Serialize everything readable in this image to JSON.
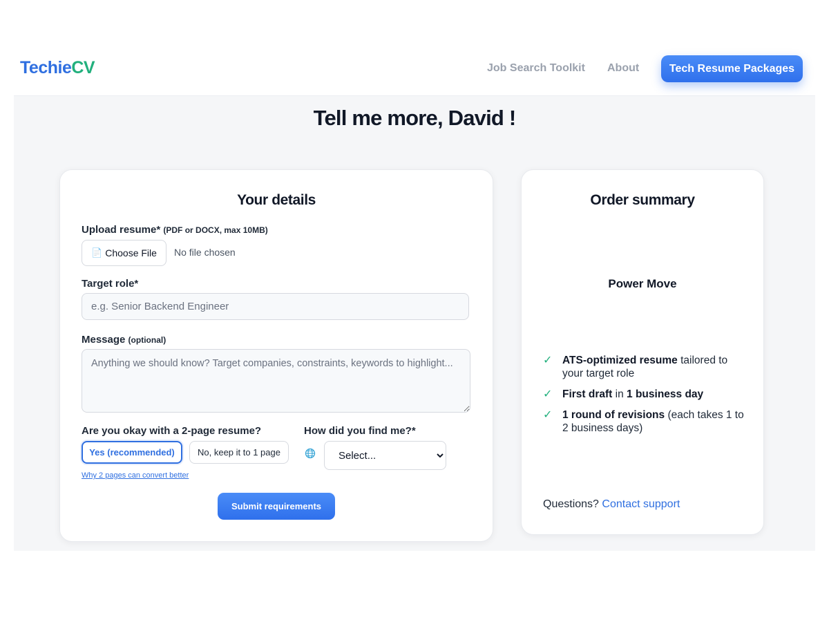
{
  "nav": {
    "logo_part1": "Techie",
    "logo_part2": "CV",
    "links": [
      "Job Search Toolkit",
      "About"
    ],
    "cta": "Tech Resume Packages"
  },
  "page_title": "Tell me more, David !",
  "details": {
    "title": "Your details",
    "upload_label": "Upload resume*",
    "upload_hint": "(PDF or DOCX, max 10MB)",
    "choose_file": "Choose File",
    "file_status": "No file chosen",
    "target_role_label": "Target role*",
    "target_role_placeholder": "e.g. Senior Backend Engineer",
    "message_label": "Message",
    "message_hint": "(optional)",
    "message_placeholder": "Anything we should know? Target companies, constraints, keywords to highlight...",
    "two_page_question": "Are you okay with a 2-page resume?",
    "option_yes": "Yes (recommended)",
    "option_no": "No, keep it to 1 page",
    "why_link": "Why 2 pages can convert better",
    "source_question": "How did you find me?*",
    "source_selected": "Select...",
    "submit": "Submit requirements"
  },
  "summary": {
    "title": "Order summary",
    "package": "Power Move",
    "features": [
      {
        "bold": "ATS-optimized resume",
        "text": " tailored to your target role"
      },
      {
        "bold": "First draft",
        "text": " in ",
        "bold2": "1 business day"
      },
      {
        "bold": "1 round of revisions",
        "text": " (each takes 1 to 2 business days)"
      }
    ],
    "support_text": "Questions? ",
    "support_link": "Contact support"
  },
  "colors": {
    "accent": "#2f6fe0",
    "brand_green": "#22b07d",
    "page_bg": "#f5f6f8"
  }
}
